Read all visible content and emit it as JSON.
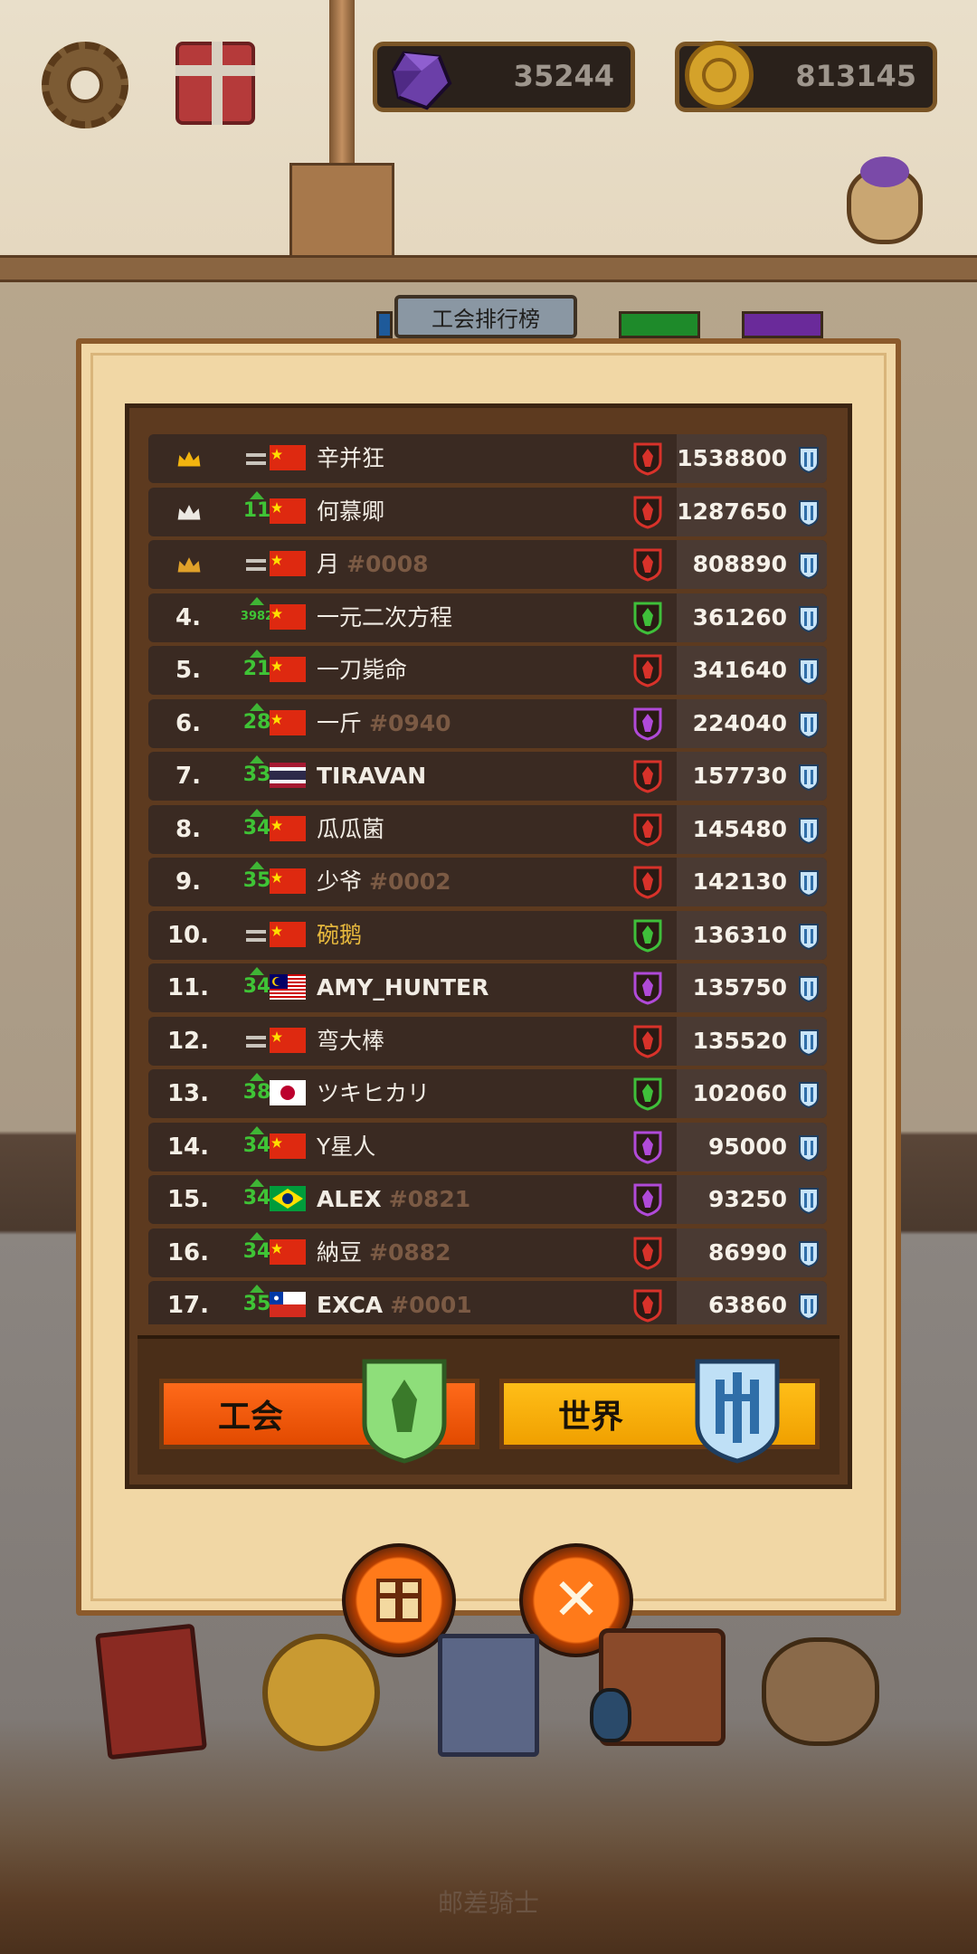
{
  "header": {
    "gems": "35244",
    "coins": "813145"
  },
  "title_tab": "工会排行榜",
  "leaderboard": [
    {
      "rank": "",
      "crown": "gold",
      "change": "=",
      "flag": "china",
      "name": "辛并狂",
      "tag": "",
      "emblem": "red",
      "score": "1538800"
    },
    {
      "rank": "",
      "crown": "silver",
      "change": "11",
      "flag": "china",
      "name": "何慕卿",
      "tag": "",
      "emblem": "red",
      "score": "1287650"
    },
    {
      "rank": "",
      "crown": "bronze",
      "change": "=",
      "flag": "china",
      "name": "月",
      "tag": "#0008",
      "emblem": "red",
      "score": "808890"
    },
    {
      "rank": "4.",
      "change": "3982",
      "flag": "china",
      "name": "一元二次方程",
      "tag": "",
      "emblem": "green",
      "score": "361260"
    },
    {
      "rank": "5.",
      "change": "21",
      "flag": "china",
      "name": "一刀毙命",
      "tag": "",
      "emblem": "red",
      "score": "341640"
    },
    {
      "rank": "6.",
      "change": "28",
      "flag": "china",
      "name": "一斤",
      "tag": "#0940",
      "emblem": "purple",
      "score": "224040"
    },
    {
      "rank": "7.",
      "change": "33",
      "flag": "thailand",
      "name": "TIRAVAN",
      "tag": "",
      "emblem": "red",
      "score": "157730"
    },
    {
      "rank": "8.",
      "change": "34",
      "flag": "china",
      "name": "瓜瓜菌",
      "tag": "",
      "emblem": "red",
      "score": "145480"
    },
    {
      "rank": "9.",
      "change": "35",
      "flag": "china",
      "name": "少爷",
      "tag": "#0002",
      "emblem": "red",
      "score": "142130"
    },
    {
      "rank": "10.",
      "change": "=",
      "flag": "china",
      "name": "碗鹅",
      "tag": "",
      "emblem": "green",
      "score": "136310",
      "highlight": true
    },
    {
      "rank": "11.",
      "change": "34",
      "flag": "malaysia",
      "name": "AMY_HUNTER",
      "tag": "",
      "emblem": "purple",
      "score": "135750"
    },
    {
      "rank": "12.",
      "change": "=",
      "flag": "china",
      "name": "弯大棒",
      "tag": "",
      "emblem": "red",
      "score": "135520"
    },
    {
      "rank": "13.",
      "change": "38",
      "flag": "japan",
      "name": "ツキヒカリ",
      "tag": "",
      "emblem": "green",
      "score": "102060"
    },
    {
      "rank": "14.",
      "change": "34",
      "flag": "china",
      "name": "Y星人",
      "tag": "",
      "emblem": "purple",
      "score": "95000"
    },
    {
      "rank": "15.",
      "change": "34",
      "flag": "brazil",
      "name": "ALEX",
      "tag": "#0821",
      "emblem": "purple",
      "score": "93250"
    },
    {
      "rank": "16.",
      "change": "34",
      "flag": "china",
      "name": "納豆",
      "tag": "#0882",
      "emblem": "red",
      "score": "86990"
    },
    {
      "rank": "17.",
      "change": "35",
      "flag": "chile",
      "name": "EXCA",
      "tag": "#0001",
      "emblem": "red",
      "score": "63860"
    }
  ],
  "buttons": {
    "guild_label": "工会",
    "world_label": "世界"
  },
  "footer_text": "邮差骑士",
  "colors": {
    "emblem_red": "#d8322a",
    "emblem_green": "#3fbf3a",
    "emblem_purple": "#b04ad8",
    "change_up": "#3fc436",
    "guild_button": "#ff5a10",
    "world_button": "#ffb40c"
  }
}
